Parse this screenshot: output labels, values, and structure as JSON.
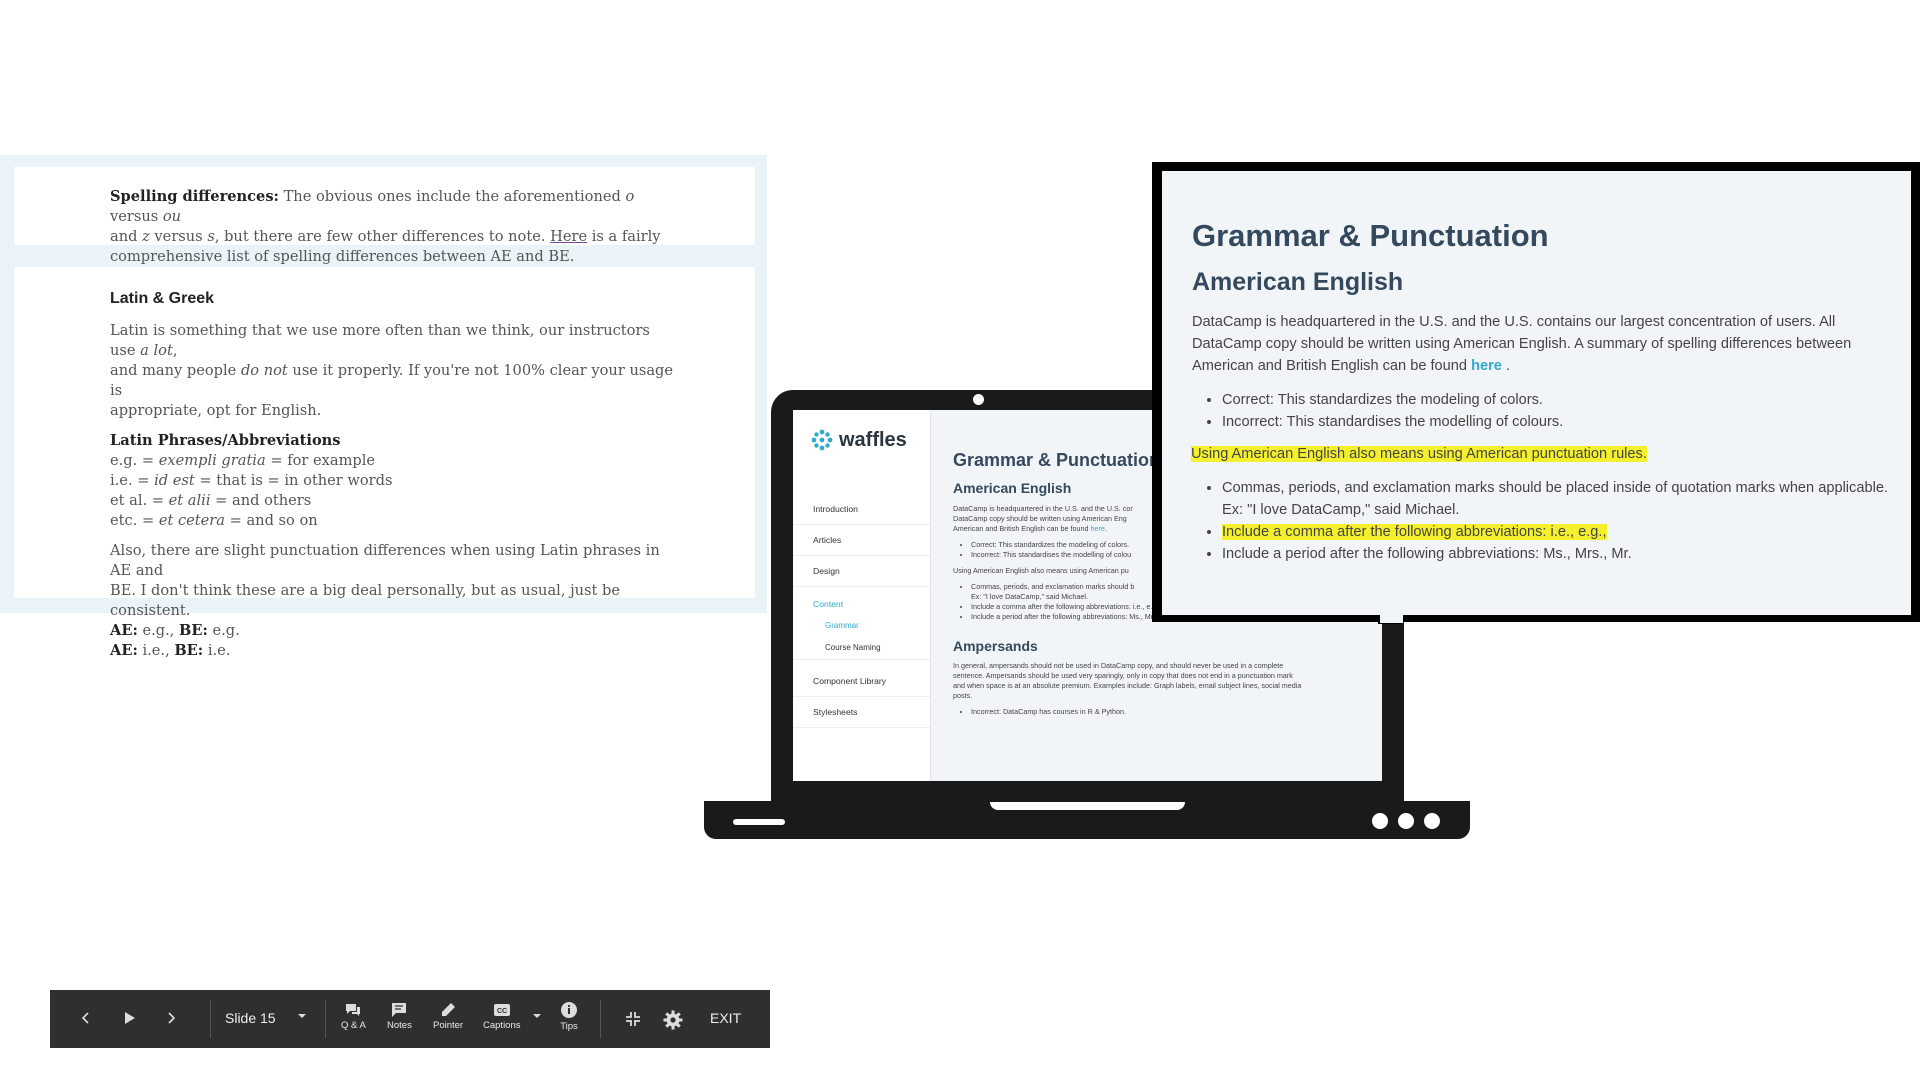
{
  "doc": {
    "spelling_title": "Spelling differences:",
    "spelling_l1a": "The obvious ones include the aforementioned ",
    "spelling_o": "o",
    "spelling_l1b": " versus ",
    "spelling_ou": "ou",
    "spelling_l2a": "and ",
    "spelling_z": "z",
    "spelling_l2b": " versus ",
    "spelling_s": "s",
    "spelling_l2c": ", but there are few other differences to note. ",
    "spelling_link": "Here",
    "spelling_l2d": " is a fairly",
    "spelling_l3": "comprehensive list of spelling differences between AE and BE.",
    "latin_title": "Latin & Greek",
    "latin_p1a": "Latin is something that we use more often than we think, our instructors use ",
    "latin_alot": "a lot",
    "latin_p1b": ",",
    "latin_p2a": "and many people ",
    "latin_donot": "do not",
    "latin_p2b": " use it properly. If you're not 100% clear your usage is",
    "latin_p3": "appropriate, opt for English.",
    "phrases_title": "Latin Phrases/Abbreviations",
    "eg_a": "e.g. = ",
    "eg_i": "exempli gratia",
    "eg_b": " = for example",
    "ie_a": "i.e. = ",
    "ie_i": "id est",
    "ie_b": " = that is = in other words",
    "etal_a": "et al. = ",
    "etal_i": "et alii",
    "etal_b": " = and others",
    "etc_a": "etc. = ",
    "etc_i": "et cetera",
    "etc_b": " = and so on",
    "also_l1": "Also, there are slight punctuation differences when using Latin phrases in AE and",
    "also_l2": "BE. I don't think these are a big deal personally, but as usual, just be consistent.",
    "ae1_k": "AE:",
    "ae1_v": " e.g., ",
    "be1_k": "BE:",
    "be1_v": " e.g.",
    "ae2_k": "AE:",
    "ae2_v": " i.e., ",
    "be2_k": "BE:",
    "be2_v": " i.e."
  },
  "screen": {
    "logo": "waffles",
    "nav": {
      "introduction": "Introduction",
      "articles": "Articles",
      "design": "Design",
      "content": "Content",
      "grammar": "Grammar",
      "course_naming": "Course Naming",
      "component_library": "Component Library",
      "stylesheets": "Stylesheets"
    },
    "h1": "Grammar & Punctuation",
    "h2": "American English",
    "p1_l1": "DataCamp is headquartered in the U.S. and the U.S. cor",
    "p1_l2": "DataCamp copy should be written using American Eng",
    "p1_l3a": "American and British English can be found ",
    "p1_link": "here",
    "p1_l3b": ".",
    "b1": "Correct: This standardizes the modeling of colors.",
    "b2": "Incorrect: This standardises the modelling of colou",
    "p2": "Using American English also means using American pu",
    "b3_l1": "Commas, periods, and exclamation marks should b",
    "b3_l2": "Ex: \"I love DataCamp,\" said Michael.",
    "b4": "Include a comma after the following abbreviations: i.e., e.g.",
    "b5": "Include a period after the following abbreviations: Ms., Mrs., Mr.",
    "h2b": "Ampersands",
    "p3_l1": "In general, ampersands should not be used in DataCamp copy, and should never be used in a complete",
    "p3_l2": "sentence. Ampersands should be used very sparingly, only in copy that does not end in a punctuation mark",
    "p3_l3": "and when space is at an absolute premium. Examples include: Graph labels, email subject lines, social media",
    "p3_l4": "posts.",
    "b6": "Incorrect: DataCamp has courses in R & Python."
  },
  "zoom": {
    "h1": "Grammar & Punctuation",
    "h2": "American English",
    "p1_l1": "DataCamp is headquartered in the U.S. and the U.S. contains our largest concentration of users. All",
    "p1_l2": "DataCamp copy should be written using American English. A summary of spelling differences between",
    "p1_l3a": "American and British English can be found ",
    "p1_link": "here",
    "p1_l3b": " .",
    "b1": "Correct: This standardizes the modeling of colors.",
    "b2": "Incorrect: This standardises the modelling of colours.",
    "highlight": "Using American English also means using American punctuation rules.",
    "b3_l1": "Commas, periods, and exclamation marks should be placed inside of quotation marks when applicable.",
    "b3_l2": "Ex: \"I love DataCamp,\" said Michael.",
    "b4": "Include a comma after the following abbreviations: i.e., e.g.,",
    "b5": "Include a period after the following abbreviations: Ms., Mrs., Mr."
  },
  "toolbar": {
    "slide_label": "Slide 15",
    "qa": "Q & A",
    "notes": "Notes",
    "pointer": "Pointer",
    "captions": "Captions",
    "tips": "Tips",
    "exit": "EXIT"
  }
}
